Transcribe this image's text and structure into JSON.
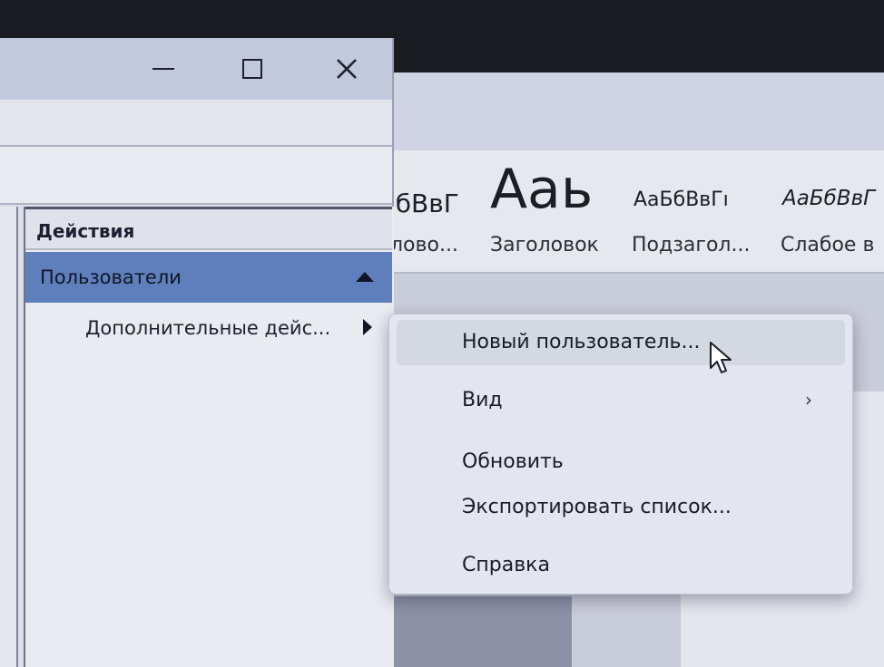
{
  "word": {
    "styles": [
      {
        "sample": "ıбВвГ",
        "name": "лово..."
      },
      {
        "sample": "Ааь",
        "name": "Заголовок"
      },
      {
        "sample": "АаБбВвГı",
        "name": "Подзагол..."
      },
      {
        "sample": "АаБбВвГ",
        "name": "Слабое в"
      }
    ]
  },
  "dialog": {
    "actions_header": "Действия",
    "users_label": "Пользователи",
    "more_actions_label": "Дополнительные дейс..."
  },
  "context_menu": {
    "items": [
      {
        "label": "Новый пользователь...",
        "submenu": false
      },
      {
        "label": "Вид",
        "submenu": true,
        "chevron": "›"
      },
      {
        "label": "Обновить",
        "submenu": false
      },
      {
        "label": "Экспортировать список...",
        "submenu": false
      },
      {
        "label": "Справка",
        "submenu": false
      }
    ]
  },
  "icons": {
    "minimize": "minimize-icon",
    "maximize": "maximize-icon",
    "close": "close-icon",
    "collapse": "collapse-up-icon",
    "submenu": "submenu-arrow-icon",
    "cursor": "mouse-pointer-icon"
  },
  "colors": {
    "selected_row": "#5f7fbc",
    "menu_hover": "#d4d8e3"
  }
}
